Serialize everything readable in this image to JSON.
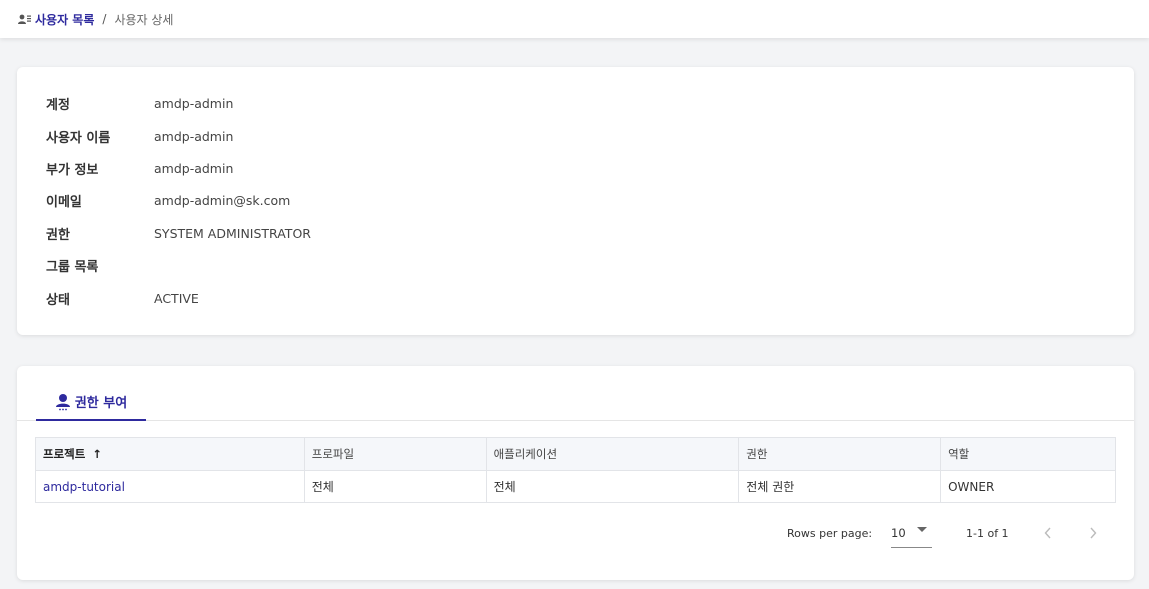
{
  "breadcrumb": {
    "parent_label": "사용자 목록",
    "current_label": "사용자 상세",
    "separator": "/"
  },
  "user": {
    "fields": [
      {
        "label": "계정",
        "value": "amdp-admin"
      },
      {
        "label": "사용자 이름",
        "value": "amdp-admin"
      },
      {
        "label": "부가 정보",
        "value": "amdp-admin"
      },
      {
        "label": "이메일",
        "value": "amdp-admin@sk.com"
      },
      {
        "label": "권한",
        "value": "SYSTEM ADMINISTRATOR"
      },
      {
        "label": "그룹 목록",
        "value": ""
      },
      {
        "label": "상태",
        "value": "ACTIVE"
      }
    ]
  },
  "permissions": {
    "tab_label": "권한 부여",
    "columns": [
      "프로젝트",
      "프로파일",
      "애플리케이션",
      "권한",
      "역할"
    ],
    "sort_indicator": "↑",
    "rows": [
      {
        "project": "amdp-tutorial",
        "profile": "전체",
        "application": "전체",
        "permission": "전체 권한",
        "role": "OWNER"
      }
    ],
    "pager": {
      "rows_per_page_label": "Rows per page:",
      "rows_per_page_value": "10",
      "range_text": "1-1 of 1"
    }
  },
  "colors": {
    "accent": "#2e2a9e",
    "background": "#f3f4f6"
  }
}
